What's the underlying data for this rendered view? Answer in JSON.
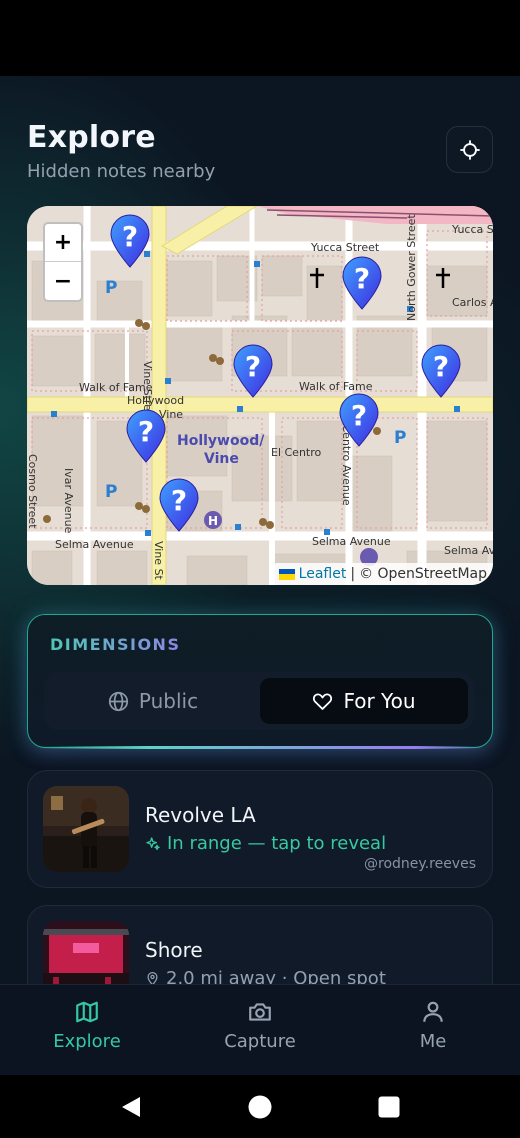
{
  "header": {
    "title": "Explore",
    "subtitle": "Hidden notes nearby",
    "locate_icon": "crosshair-icon"
  },
  "map": {
    "zoom_in": "+",
    "zoom_out": "−",
    "attribution": {
      "leaflet": "Leaflet",
      "separator": "|",
      "osm": "© OpenStreetMap"
    },
    "labels": {
      "yucca_street": "Yucca Street",
      "yucca_s": "Yucca S",
      "carlos": "Carlos A",
      "north_gower": "North Gower Street",
      "vine_street": "Vine Street",
      "walk_of_fame_left": "Walk of Fame",
      "walk_of_fame_right": "Walk of Fame",
      "hollywood": "Hollywood",
      "vine": "Vine",
      "station": "Hollywood/",
      "station2": "Vine",
      "el_centro": "El Centro",
      "el_centro_ave": "El Centro Avenue",
      "ivar_avenue": "Ivar Avenue",
      "cosmo_street": "Cosmo Street",
      "selma_left": "Selma Avenue",
      "selma_mid": "Selma Avenue",
      "selma_right": "Selma Av",
      "vine_street_bottom": "Vine St"
    },
    "pin_icon": "question-map-pin-icon",
    "pin_count": 7,
    "pin_color": "#3f2be0"
  },
  "dimensions": {
    "label": "DIMENSIONS",
    "options": [
      {
        "label": "Public",
        "icon": "globe-icon",
        "selected": false
      },
      {
        "label": "For You",
        "icon": "heart-icon",
        "selected": true
      }
    ]
  },
  "notes": [
    {
      "title": "Revolve LA",
      "status": "In range — tap to reveal",
      "status_icon": "sparkle-icon",
      "author": "@rodney.reeves"
    },
    {
      "title": "Shore",
      "status": "2.0 mi away · Open spot",
      "status_icon": "location-pin-icon"
    }
  ],
  "bottom_nav": [
    {
      "label": "Explore",
      "icon": "map-icon",
      "active": true
    },
    {
      "label": "Capture",
      "icon": "camera-icon",
      "active": false
    },
    {
      "label": "Me",
      "icon": "person-icon",
      "active": false
    }
  ],
  "colors": {
    "accent": "#35c8a4",
    "background": "#0c1522",
    "purple": "#8f86e6"
  }
}
